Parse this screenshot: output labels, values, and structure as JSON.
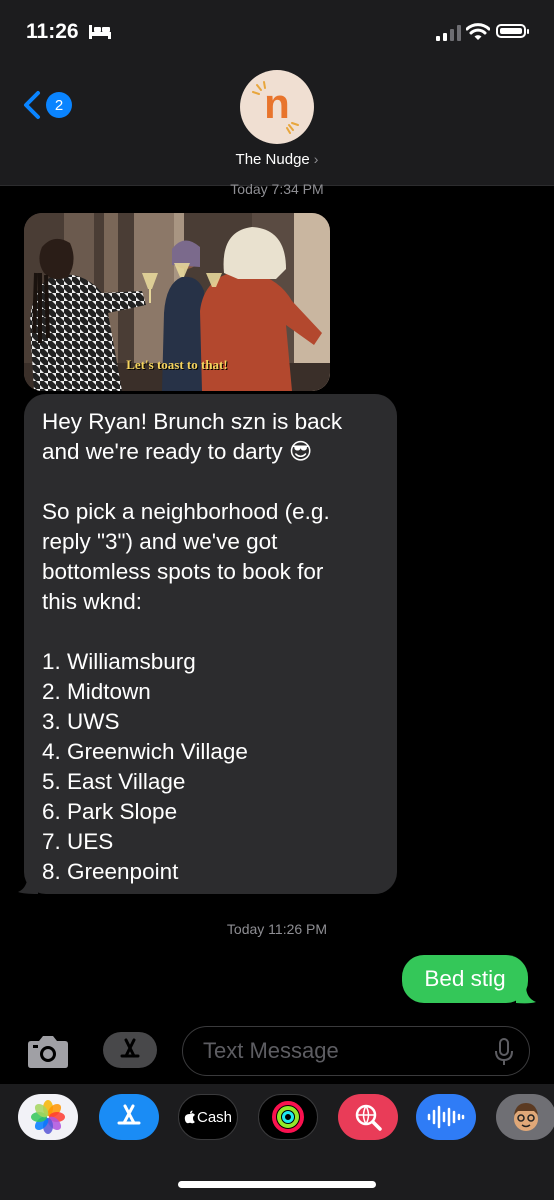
{
  "status_bar": {
    "time": "11:26",
    "icons": [
      "bed-icon",
      "signal-icon",
      "wifi-icon",
      "battery-icon"
    ]
  },
  "header": {
    "back_badge": "2",
    "avatar_letter": "n",
    "contact_name": "The Nudge",
    "contact_chevron": "›"
  },
  "messages": {
    "timestamp_1_day": "Today",
    "timestamp_1_time": "7:34 PM",
    "gif_caption": "Let's toast to that!",
    "incoming": {
      "line_1": "Hey Ryan! Brunch szn is back",
      "line_2": "and we're ready to darty 😎",
      "line_3": "So pick a neighborhood (e.g.",
      "line_4": "reply \"3\") and we've got",
      "line_5": "bottomless spots to book for",
      "line_6": "this wknd:",
      "options": [
        "1. Williamsburg",
        "2. Midtown",
        "3. UWS",
        "4. Greenwich Village",
        "5. East Village",
        "6. Park Slope",
        "7. UES",
        "8. Greenpoint"
      ]
    },
    "timestamp_2_day": "Today",
    "timestamp_2_time": "11:26 PM",
    "outgoing": "Bed stig"
  },
  "input": {
    "placeholder": "Text Message"
  },
  "app_drawer": {
    "apps": [
      "photos-icon",
      "app-store-icon",
      "apple-cash-icon",
      "fitness-icon",
      "web-search-icon",
      "audio-message-icon",
      "memoji-icon"
    ],
    "cash_label": "Cash"
  },
  "colors": {
    "incoming_bubble": "#2c2c2e",
    "outgoing_bubble": "#34c759",
    "accent": "#0a84ff",
    "background": "#000000"
  }
}
